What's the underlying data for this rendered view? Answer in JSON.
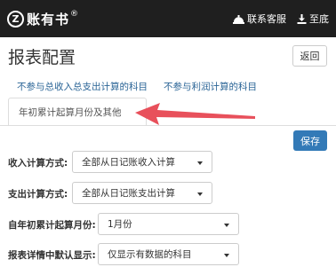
{
  "header": {
    "logo_glyph": "Z",
    "logo_text": "账有书",
    "logo_mark": "®",
    "nav": [
      {
        "label": "联系客服",
        "icon": "customer-service-icon"
      },
      {
        "label": "至底",
        "icon": "download-icon"
      }
    ]
  },
  "page": {
    "title": "报表配置",
    "back_label": "返回",
    "save_label": "保存"
  },
  "tabs": {
    "links": [
      "不参与总收入总支出计算的科目",
      "不参与利润计算的科目"
    ],
    "active": "年初累计起算月份及其他"
  },
  "form": {
    "fields": [
      {
        "label": "收入计算方式:",
        "value": "全部从日记账收入计算"
      },
      {
        "label": "支出计算方式:",
        "value": "全部从日记账支出计算"
      },
      {
        "label": "自年初累计起算月份:",
        "value": "1月份"
      },
      {
        "label": "报表详情中默认显示:",
        "value": "仅显示有数据的科目"
      }
    ]
  },
  "colors": {
    "topbar": "#1f1f1f",
    "link": "#2a6496",
    "primary_button": "#337ab7",
    "annotation_arrow": "#e8505b"
  }
}
